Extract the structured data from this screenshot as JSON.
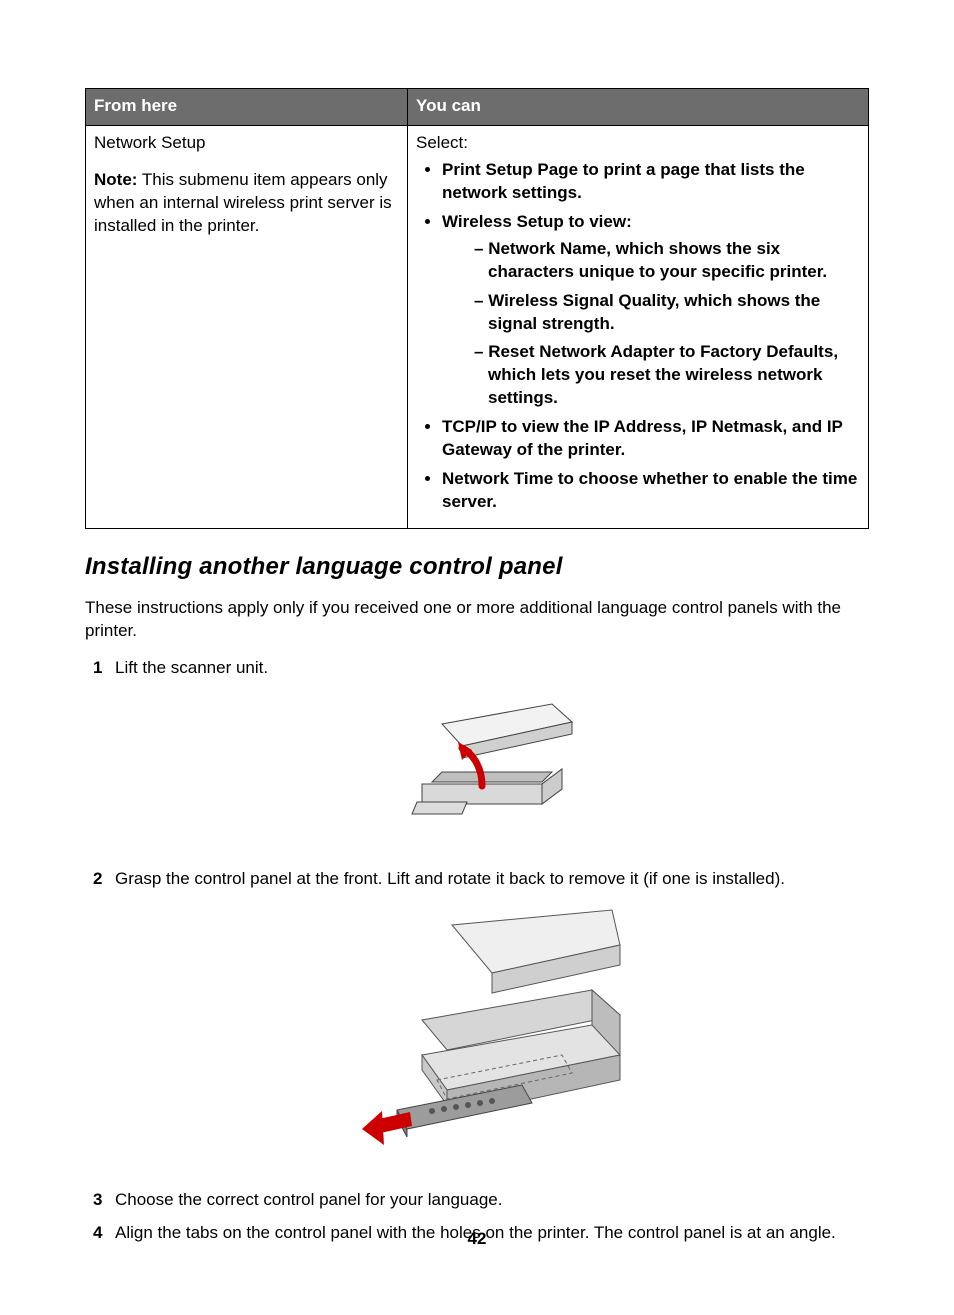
{
  "table": {
    "headers": [
      "From here",
      "You can"
    ],
    "col1": {
      "title": "Network Setup",
      "note_label": "Note:",
      "note_text": " This submenu item appears only when an internal wireless print server is installed in the printer."
    },
    "col2": {
      "lead": "Select:",
      "bullets": [
        {
          "bold": "Print Setup Page",
          "rest": " to print a page that lists the network settings."
        },
        {
          "bold": "Wireless Setup",
          "rest": " to view:"
        }
      ],
      "sub": [
        {
          "bold": "Network Name",
          "rest": ", which shows the six characters unique to your specific printer."
        },
        {
          "bold": "Wireless Signal Quality",
          "rest": ", which shows the signal strength."
        },
        {
          "bold": "Reset Network Adapter to Factory Defaults",
          "rest": ", which lets you reset the wireless network settings."
        }
      ],
      "bullets2": [
        {
          "bold": "TCP/IP",
          "rest": " to view the IP Address, IP Netmask, and IP Gateway of the printer."
        },
        {
          "bold": "Network Time",
          "rest": " to choose whether to enable the time server."
        }
      ]
    }
  },
  "section_title": "Installing another language control panel",
  "intro": "These instructions apply only if you received one or more additional language control panels with the printer.",
  "steps": [
    "Lift the scanner unit.",
    "Grasp the control panel at the front. Lift and rotate it back to remove it (if one is installed).",
    "Choose the correct control panel for your language.",
    "Align the tabs on the control panel with the holes on the printer. The control panel is at an angle."
  ],
  "page_number": "42"
}
